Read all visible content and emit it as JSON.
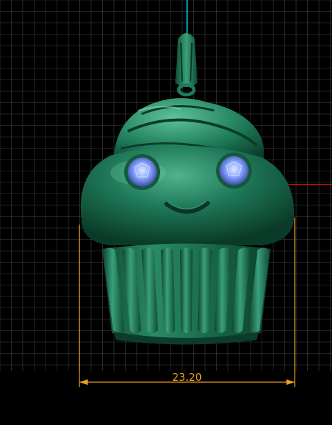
{
  "viewport": {
    "name": "3d-model-viewport",
    "background_color": "#000000",
    "grid_color": "#7a7a7a",
    "grid": true
  },
  "axes": {
    "vertical_axis_color": "#00c8d8",
    "horizontal_axis_color": "#e01010"
  },
  "model": {
    "subject": "cupcake-pendant",
    "body_color": "#1f7a5a",
    "gem_color": "#8aa6ff",
    "gem_count": 2
  },
  "dimension": {
    "value": "23.20",
    "color": "#f0a020"
  }
}
